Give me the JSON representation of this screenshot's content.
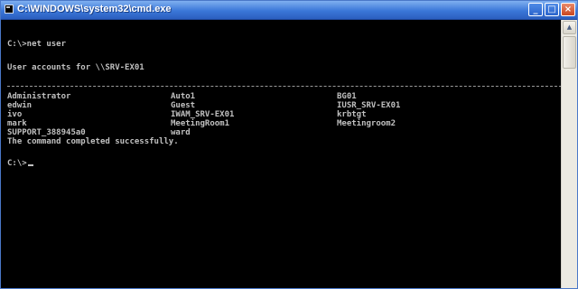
{
  "window": {
    "title": "C:\\WINDOWS\\system32\\cmd.exe",
    "controls": {
      "minimize": "_",
      "maximize": "□",
      "close": "×"
    }
  },
  "console": {
    "prompt1": "C:\\>net user",
    "header": "User accounts for \\\\SRV-EX01",
    "accounts": [
      "Administrator",
      "Auto1",
      "BG01",
      "edwin",
      "Guest",
      "IUSR_SRV-EX01",
      "ivo",
      "IWAM_SRV-EX01",
      "krbtgt",
      "mark",
      "MeetingRoom1",
      "Meetingroom2",
      "SUPPORT_388945a0",
      "ward"
    ],
    "completed": "The command completed successfully.",
    "prompt2": "C:\\>"
  },
  "scrollbar": {
    "up_arrow": "▲"
  },
  "colors": {
    "console_bg": "#000000",
    "console_text": "#c0c0c0",
    "titlebar": "#3b77d8"
  }
}
